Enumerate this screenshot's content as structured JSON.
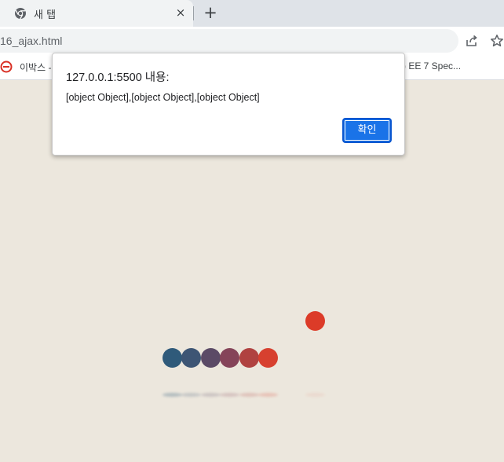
{
  "browser": {
    "tab": {
      "title": "새 탭",
      "close_icon": "×",
      "favicon": "chrome-icon"
    },
    "new_tab_icon": "+",
    "address_bar": {
      "url": "16_ajax.html"
    },
    "toolbar_icons": [
      "share-icon",
      "star-icon"
    ],
    "bookmarks": [
      {
        "label": "이박스 -",
        "icon": "bookmark-site-icon"
      },
      {
        "label": ") EE 7 Spec..."
      }
    ]
  },
  "dialog": {
    "title": "127.0.0.1:5500 내용:",
    "message": "[object Object],[object Object],[object Object]",
    "ok_label": "확인"
  },
  "colors": {
    "page_background": "#ece7dd",
    "accent": "#1a73e8",
    "dots": [
      "#2f5a7a",
      "#3d5574",
      "#5b4a66",
      "#854459",
      "#b04240",
      "#d7402f"
    ],
    "floating_dot": "#dc3b28"
  }
}
